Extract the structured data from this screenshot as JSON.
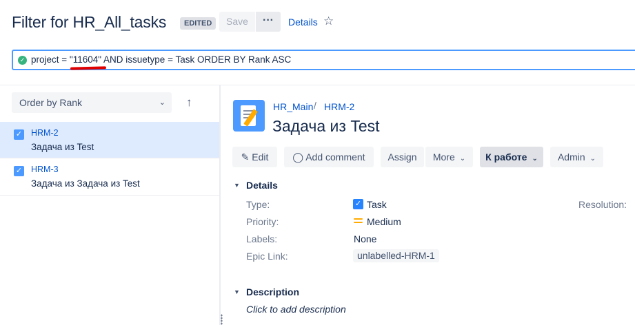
{
  "header": {
    "title": "Filter for HR_All_tasks",
    "status_lozenge": "EDITED",
    "save_label": "Save",
    "more_label": "···",
    "details_label": "Details",
    "star_icon": "star-outline-icon"
  },
  "jql": {
    "query": "project = \"11604\" AND issuetype = Task ORDER BY Rank ASC",
    "valid_icon": "check-circle-icon",
    "annotation_color": "#E00000"
  },
  "list": {
    "order_label": "Order by Rank",
    "sort_icon": "arrow-up-icon",
    "items": [
      {
        "key": "HRM-2",
        "summary": "Задача из Test",
        "selected": true
      },
      {
        "key": "HRM-3",
        "summary": "Задача из Задача из Test",
        "selected": false
      }
    ]
  },
  "issue": {
    "project": "HR_Main",
    "separator": "/",
    "key": "HRM-2",
    "title": "Задача из Test",
    "icon": "story-pencil-icon"
  },
  "toolbar": {
    "edit": "Edit",
    "add_comment": "Add comment",
    "assign": "Assign",
    "more": "More",
    "transition": "К работе",
    "admin": "Admin"
  },
  "details": {
    "heading": "Details",
    "type_label": "Type:",
    "type_value": "Task",
    "priority_label": "Priority:",
    "priority_value": "Medium",
    "labels_label": "Labels:",
    "labels_value": "None",
    "epic_label": "Epic Link:",
    "epic_value": "unlabelled-HRM-1",
    "resolution_label": "Resolution:"
  },
  "description": {
    "heading": "Description",
    "placeholder": "Click to add description"
  },
  "colors": {
    "link": "#0052CC",
    "selected_row": "#DEEBFF",
    "checkbox": "#4C9AFF",
    "priority_medium": "#FFAB00",
    "valid": "#36B37E"
  }
}
